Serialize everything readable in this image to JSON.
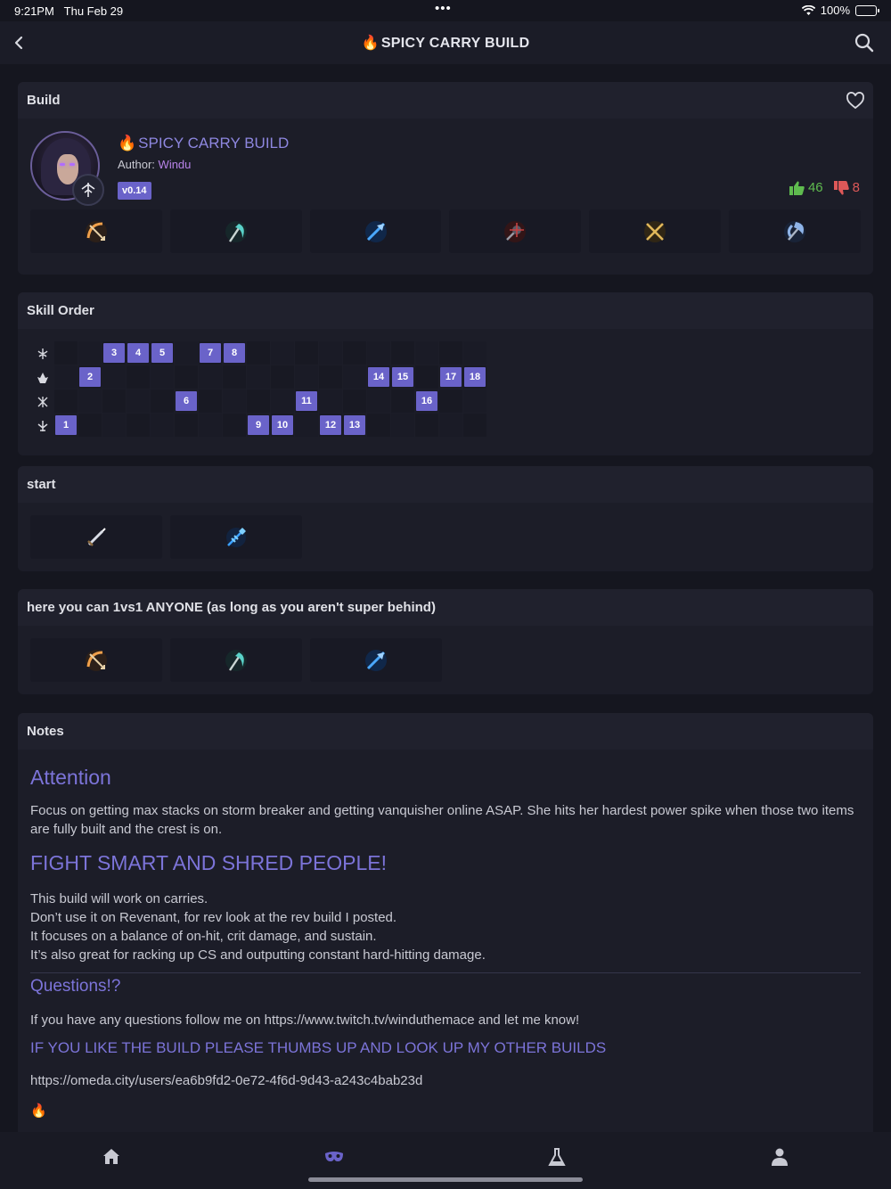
{
  "status": {
    "time": "9:21PM",
    "date": "Thu Feb 29",
    "dots": "•••",
    "battery": "100%"
  },
  "nav": {
    "title": "SPICY CARRY BUILD",
    "flame": "🔥"
  },
  "build_card": {
    "header": "Build",
    "title": "SPICY CARRY BUILD",
    "author_label": "Author:",
    "author_name": "Windu",
    "version": "v0.14",
    "upvotes": "46",
    "downvotes": "8",
    "items": [
      "bow-icon",
      "scythe-icon",
      "arrow-icon",
      "mace-icon",
      "crossed-blades-icon",
      "axe-icon"
    ]
  },
  "skill_order": {
    "header": "Skill Order",
    "columns": 18,
    "rows": [
      {
        "icon": "skill-rmb-icon",
        "levels": [
          "3",
          "4",
          "5",
          "7",
          "8"
        ],
        "cols": [
          3,
          4,
          5,
          7,
          8
        ]
      },
      {
        "icon": "skill-q-icon",
        "levels": [
          "2",
          "14",
          "15",
          "17",
          "18"
        ],
        "cols": [
          2,
          14,
          15,
          17,
          18
        ]
      },
      {
        "icon": "skill-e-icon",
        "levels": [
          "6",
          "11",
          "16"
        ],
        "cols": [
          6,
          11,
          16
        ]
      },
      {
        "icon": "skill-r-icon",
        "levels": [
          "1",
          "9",
          "10",
          "12",
          "13"
        ],
        "cols": [
          1,
          9,
          10,
          12,
          13
        ]
      }
    ]
  },
  "start_section": {
    "header": "start",
    "items": [
      "dagger-icon",
      "crystal-spear-icon"
    ]
  },
  "core_section": {
    "header": "here you can 1vs1 ANYONE (as long as you aren't super behind)",
    "items": [
      "bow-icon",
      "scythe-icon",
      "arrow-icon"
    ]
  },
  "notes": {
    "header": "Notes",
    "attention": "Attention",
    "para1": "Focus on getting max stacks on storm breaker and getting vanquisher online ASAP. She hits her hardest power spike when those two items are fully built and the crest is on.",
    "heading2": "FIGHT SMART AND SHRED PEOPLE!",
    "lines": [
      "This build will work on carries.",
      "Don’t use it on Revenant, for rev look at the rev build I posted.",
      "It focuses on a balance of on-hit, crit damage, and sustain.",
      "It’s also great for racking up CS and outputting constant hard-hitting damage."
    ],
    "questions": "Questions!?",
    "para3": "If you have any questions follow me on https://www.twitch.tv/winduthemace and let me know!",
    "like": "IF YOU LIKE THE BUILD PLEASE THUMBS UP AND LOOK UP MY OTHER BUILDS",
    "link": "https://omeda.city/users/ea6b9fd2-0e72-4f6d-9d43-a243c4bab23d",
    "flame": "🔥"
  },
  "tabs": [
    "home-icon",
    "mask-icon",
    "flask-icon",
    "profile-icon"
  ],
  "colors": {
    "accent": "#6a63c9",
    "heading": "#7c74d9",
    "author": "#b783e8",
    "up": "#5fbb4f",
    "down": "#de5858"
  }
}
